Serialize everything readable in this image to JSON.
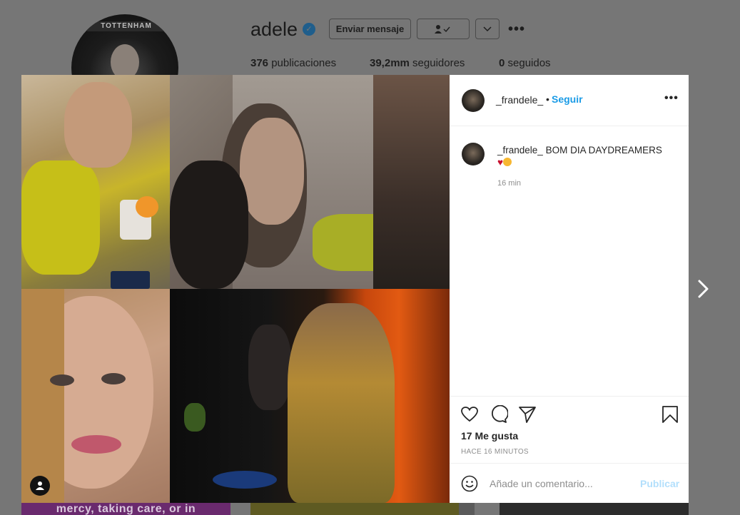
{
  "profile": {
    "username": "adele",
    "avatar_banner": "TOTTENHAM",
    "message_button": "Enviar mensaje",
    "stats": [
      {
        "value": "376",
        "label": "publicaciones"
      },
      {
        "value": "39,2mm",
        "label": "seguidores"
      },
      {
        "value": "0",
        "label": "seguidos"
      }
    ],
    "bottom_caption": "mercy, taking care, or in"
  },
  "post": {
    "author": "_frandele_",
    "separator": "•",
    "follow_label": "Seguir",
    "caption_author": "_frandele_",
    "caption_text": "BOM DIA DAYDREAMERS",
    "caption_emoji_heart": "♥",
    "caption_time": "16 min",
    "likes": "17 Me gusta",
    "posted_ago": "HACE 16 MINUTOS",
    "comment_placeholder": "Añade un comentario...",
    "publish_label": "Publicar"
  },
  "colors": {
    "accent_blue": "#1a9be6",
    "publish_disabled": "#b2dffc",
    "overlay": "#767676"
  }
}
